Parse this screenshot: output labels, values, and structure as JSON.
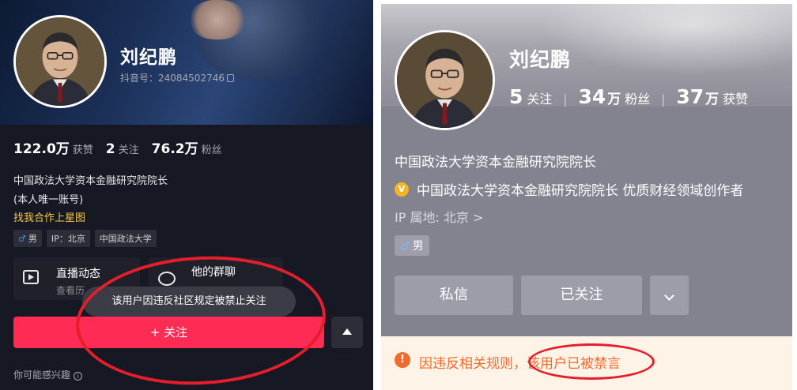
{
  "left_panel": {
    "name": "刘纪鹏",
    "douyin_id": "抖音号：24084502746",
    "stats": [
      {
        "value": "122.0万",
        "label": "获赞"
      },
      {
        "value": "2",
        "label": "关注"
      },
      {
        "value": "76.2万",
        "label": "粉丝"
      }
    ],
    "bio_line1": "中国政法大学资本金融研究院院长",
    "bio_line2": "(本人唯一账号)",
    "cooperation_link": "找我合作上星图",
    "tags": {
      "gender": "男",
      "ip": "IP：北京",
      "school": "中国政法大学"
    },
    "cards": [
      {
        "title": "直播动态",
        "subtitle": "查看历"
      },
      {
        "title": "他的群聊"
      }
    ],
    "toast": "该用户因违反社区规定被禁止关注",
    "follow_button": "+ 关注",
    "suggest_text": "你可能感兴趣",
    "info_symbol": "i",
    "icons": [
      "copy-icon",
      "live-icon",
      "group-chat-icon",
      "collapse-up-icon",
      "info-icon",
      "male-icon"
    ]
  },
  "right_panel": {
    "name": "刘纪鹏",
    "stats": [
      {
        "value": "5",
        "unit": "",
        "label": "关注"
      },
      {
        "value": "34",
        "unit": "万",
        "label": "粉丝"
      },
      {
        "value": "37",
        "unit": "万",
        "label": "获赞"
      }
    ],
    "bio_line1": "中国政法大学资本金融研究院院长",
    "bio_line2": "中国政法大学资本金融研究院院长 优质财经领域创作者",
    "ip_location": "IP 属地: 北京 >",
    "gender_tag": "男",
    "buttons": {
      "message": "私信",
      "followed": "已关注"
    },
    "warning_symbol": "!",
    "warning_text": "因违反相关规则，该用户已被禁言",
    "icons": [
      "verified-badge-icon",
      "chevron-down-icon",
      "warning-icon",
      "male-icon"
    ]
  },
  "colors": {
    "follow_red": "#fe2c55",
    "annotation_red": "#e41e2b",
    "warning_orange": "#f26a2e",
    "coop_yellow": "#f7c84b"
  }
}
